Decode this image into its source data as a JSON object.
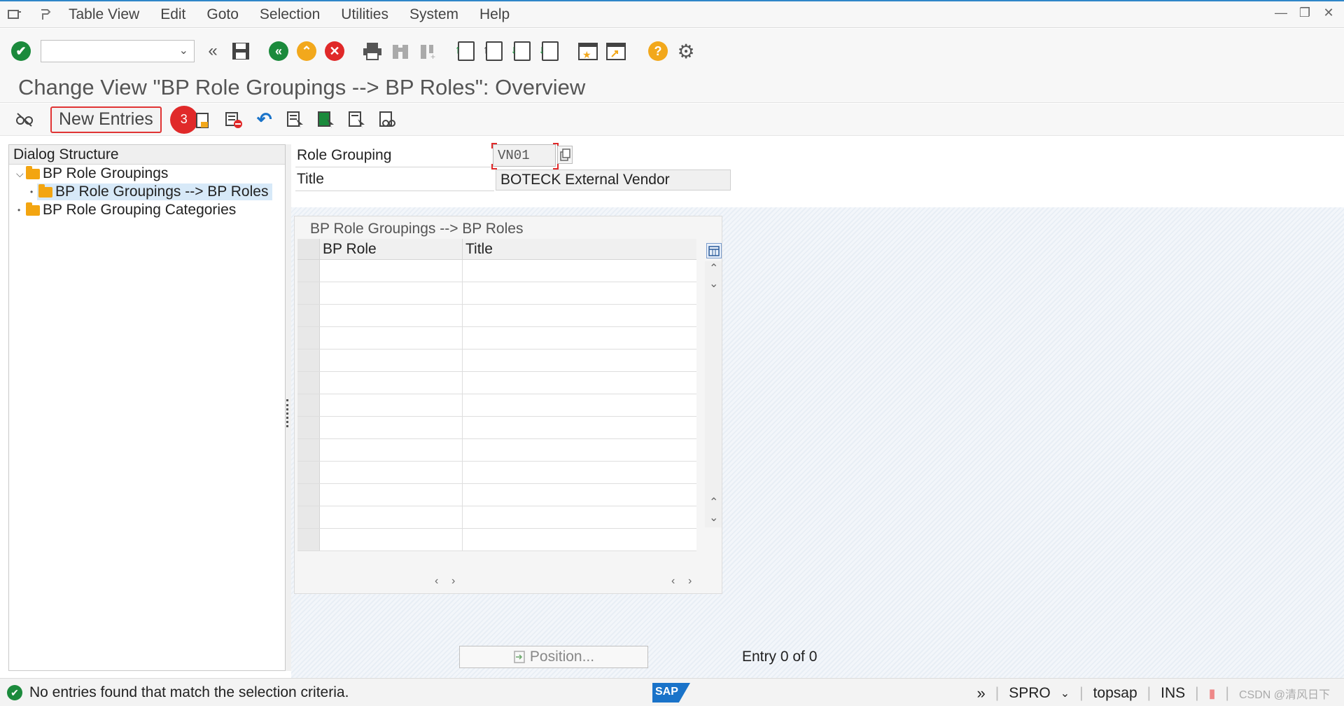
{
  "menu": {
    "items": [
      "Table View",
      "Edit",
      "Goto",
      "Selection",
      "Utilities",
      "System",
      "Help"
    ]
  },
  "title": "Change View \"BP Role Groupings --> BP Roles\": Overview",
  "app_toolbar": {
    "new_entries_label": "New Entries",
    "step_badge": "3"
  },
  "dialog_structure": {
    "header": "Dialog Structure",
    "nodes": [
      {
        "label": "BP Role Groupings",
        "toggle": "⌵"
      },
      {
        "label": "BP Role Groupings --> BP Roles",
        "toggle": "•"
      },
      {
        "label": "BP Role Grouping Categories",
        "toggle": "•"
      }
    ]
  },
  "form": {
    "role_grouping_label": "Role Grouping",
    "role_grouping_value": "VN01",
    "title_label": "Title",
    "title_value": "BOTECK External Vendor"
  },
  "table": {
    "title": "BP Role Groupings --> BP Roles",
    "columns": [
      "BP Role",
      "Title"
    ],
    "row_count": 13
  },
  "position_button": "Position...",
  "entry_count": "Entry 0 of 0",
  "status": {
    "message": "No entries found that match the selection criteria.",
    "sap_logo": "SAP",
    "transaction": "SPRO",
    "server": "topsap",
    "mode": "INS",
    "watermark": "CSDN @清风日下"
  },
  "colors": {
    "accent": "#2e86c8",
    "ok_green": "#1b8a3c",
    "cancel_red": "#e02929",
    "folder_orange": "#f3a511",
    "selection_blue": "#d7e9f8"
  }
}
